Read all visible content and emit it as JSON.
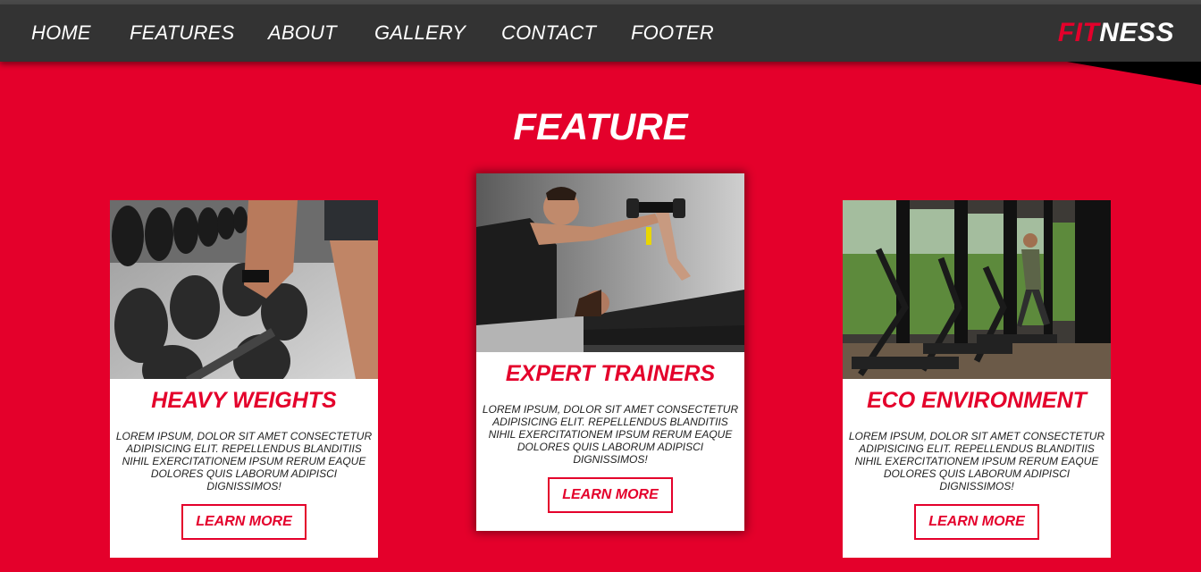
{
  "nav": {
    "items": [
      "HOME",
      "FEATURES",
      "ABOUT",
      "GALLERY",
      "CONTACT",
      "FOOTER"
    ],
    "logo_red": "FIT",
    "logo_white": "NESS"
  },
  "section": {
    "title": "FEATURE"
  },
  "cards": [
    {
      "title": "HEAVY WEIGHTS",
      "text": "LOREM IPSUM, DOLOR SIT AMET CONSECTETUR ADIPISICING ELIT. REPELLENDUS BLANDITIIS NIHIL EXERCITATIONEM IPSUM RERUM EAQUE DOLORES QUIS LABORUM ADIPISCI DIGNISSIMOS!",
      "button": "LEARN MORE",
      "photo": "dumbbell-rack-photo"
    },
    {
      "title": "EXPERT TRAINERS",
      "text": "LOREM IPSUM, DOLOR SIT AMET CONSECTETUR ADIPISICING ELIT. REPELLENDUS BLANDITIIS NIHIL EXERCITATIONEM IPSUM RERUM EAQUE DOLORES QUIS LABORUM ADIPISCI DIGNISSIMOS!",
      "button": "LEARN MORE",
      "photo": "trainer-spotting-bench-press-photo"
    },
    {
      "title": "ECO ENVIRONMENT",
      "text": "LOREM IPSUM, DOLOR SIT AMET CONSECTETUR ADIPISICING ELIT. REPELLENDUS BLANDITIIS NIHIL EXERCITATIONEM IPSUM RERUM EAQUE DOLORES QUIS LABORUM ADIPISCI DIGNISSIMOS!",
      "button": "LEARN MORE",
      "photo": "treadmill-gym-windows-photo"
    }
  ],
  "colors": {
    "accent": "#e4002b",
    "navbar": "#333333",
    "white": "#ffffff"
  }
}
